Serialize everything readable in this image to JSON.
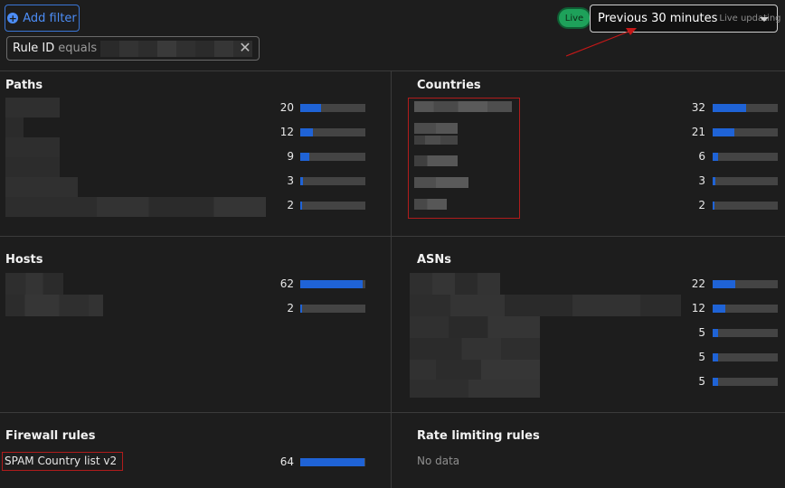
{
  "toolbar": {
    "add_filter_label": "Add filter",
    "filter_chip": {
      "field": "Rule ID",
      "operator": "equals"
    },
    "live_label": "Live",
    "time_range": "Previous 30 minutes",
    "time_range_sub": "Live updating"
  },
  "panels": {
    "paths": {
      "title": "Paths",
      "rows": [
        {
          "count": "20",
          "fraction": 0.32
        },
        {
          "count": "12",
          "fraction": 0.2
        },
        {
          "count": "9",
          "fraction": 0.14
        },
        {
          "count": "3",
          "fraction": 0.04
        },
        {
          "count": "2",
          "fraction": 0.03
        }
      ]
    },
    "countries": {
      "title": "Countries",
      "rows": [
        {
          "count": "32",
          "fraction": 0.52
        },
        {
          "count": "21",
          "fraction": 0.34
        },
        {
          "count": "6",
          "fraction": 0.09
        },
        {
          "count": "3",
          "fraction": 0.04
        },
        {
          "count": "2",
          "fraction": 0.03
        }
      ]
    },
    "hosts": {
      "title": "Hosts",
      "rows": [
        {
          "count": "62",
          "fraction": 0.96
        },
        {
          "count": "2",
          "fraction": 0.03
        }
      ]
    },
    "asns": {
      "title": "ASNs",
      "rows": [
        {
          "count": "22",
          "fraction": 0.35
        },
        {
          "count": "12",
          "fraction": 0.19
        },
        {
          "count": "5",
          "fraction": 0.08
        },
        {
          "count": "5",
          "fraction": 0.08
        },
        {
          "count": "5",
          "fraction": 0.08
        }
      ]
    },
    "firewall": {
      "title": "Firewall rules",
      "rows": [
        {
          "label": "SPAM Country list v2",
          "count": "64",
          "fraction": 0.99
        }
      ]
    },
    "rate_limiting": {
      "title": "Rate limiting rules",
      "empty_text": "No data"
    }
  },
  "colors": {
    "background": "#1d1d1d",
    "bar_fill": "#1f63d6",
    "bar_track": "#444444",
    "accent_blue": "#4c8df6",
    "live_green": "#1ea15a",
    "annotation_red": "#b01c1c"
  },
  "icons": {
    "add_filter": "plus-circle-icon",
    "remove_filter": "close-icon",
    "dropdown": "chevron-down-icon"
  }
}
